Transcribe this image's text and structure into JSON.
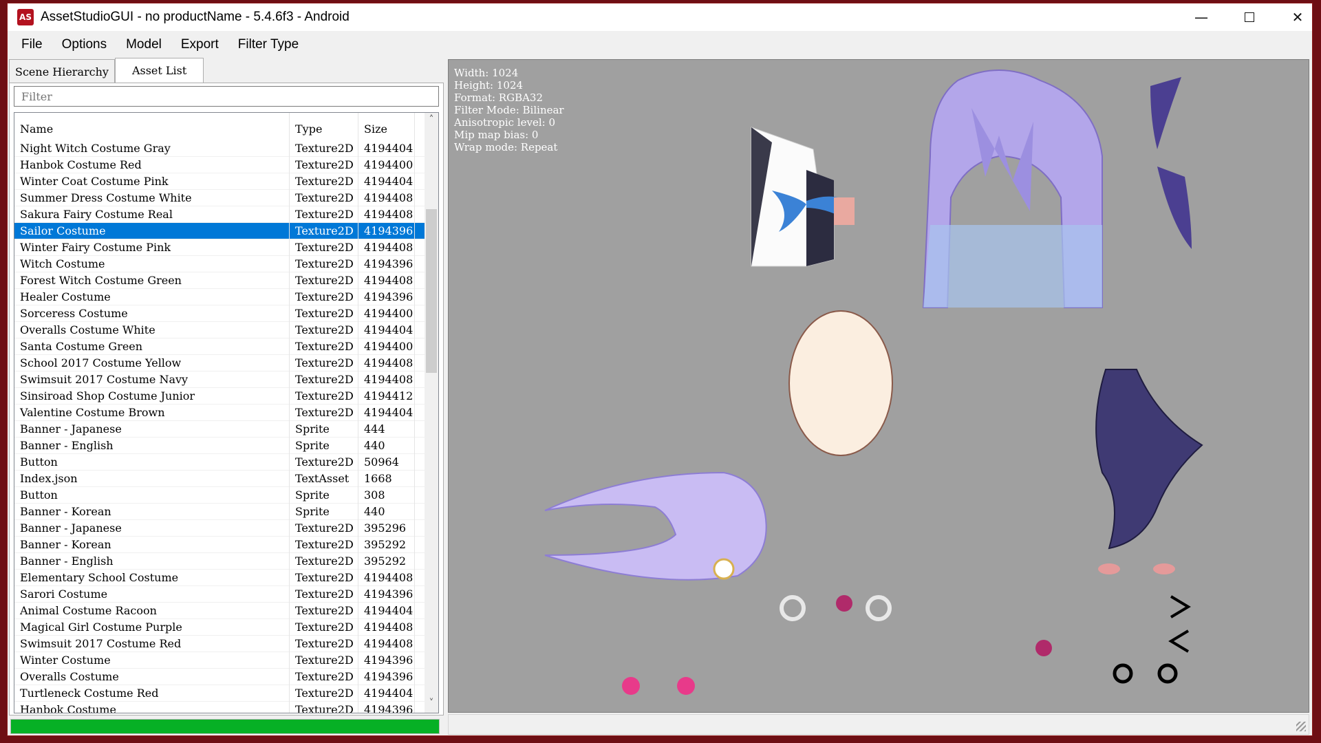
{
  "window": {
    "title": "AssetStudioGUI - no productName - 5.4.6f3 - Android",
    "icon_text": "AS"
  },
  "menu": [
    "File",
    "Options",
    "Model",
    "Export",
    "Filter Type"
  ],
  "tabs": [
    "Scene Hierarchy",
    "Asset List"
  ],
  "filter": {
    "placeholder": "Filter"
  },
  "list": {
    "columns": [
      "Name",
      "Type",
      "Size"
    ],
    "rows": [
      {
        "name": "Night Witch Costume Gray",
        "type": "Texture2D",
        "size": "4194404"
      },
      {
        "name": "Hanbok Costume Red",
        "type": "Texture2D",
        "size": "4194400"
      },
      {
        "name": "Winter Coat Costume Pink",
        "type": "Texture2D",
        "size": "4194404"
      },
      {
        "name": "Summer Dress Costume White",
        "type": "Texture2D",
        "size": "4194408"
      },
      {
        "name": "Sakura Fairy Costume Real",
        "type": "Texture2D",
        "size": "4194408"
      },
      {
        "name": "Sailor Costume",
        "type": "Texture2D",
        "size": "4194396"
      },
      {
        "name": "Winter Fairy Costume Pink",
        "type": "Texture2D",
        "size": "4194408"
      },
      {
        "name": "Witch Costume",
        "type": "Texture2D",
        "size": "4194396"
      },
      {
        "name": "Forest Witch Costume Green",
        "type": "Texture2D",
        "size": "4194408"
      },
      {
        "name": "Healer Costume",
        "type": "Texture2D",
        "size": "4194396"
      },
      {
        "name": "Sorceress Costume",
        "type": "Texture2D",
        "size": "4194400"
      },
      {
        "name": "Overalls Costume White",
        "type": "Texture2D",
        "size": "4194404"
      },
      {
        "name": "Santa Costume Green",
        "type": "Texture2D",
        "size": "4194400"
      },
      {
        "name": "School 2017 Costume Yellow",
        "type": "Texture2D",
        "size": "4194408"
      },
      {
        "name": "Swimsuit 2017 Costume Navy",
        "type": "Texture2D",
        "size": "4194408"
      },
      {
        "name": "Sinsiroad Shop Costume Junior",
        "type": "Texture2D",
        "size": "4194412"
      },
      {
        "name": "Valentine Costume Brown",
        "type": "Texture2D",
        "size": "4194404"
      },
      {
        "name": "Banner - Japanese",
        "type": "Sprite",
        "size": "444"
      },
      {
        "name": "Banner - English",
        "type": "Sprite",
        "size": "440"
      },
      {
        "name": "Button",
        "type": "Texture2D",
        "size": "50964"
      },
      {
        "name": "Index.json",
        "type": "TextAsset",
        "size": "1668"
      },
      {
        "name": "Button",
        "type": "Sprite",
        "size": "308"
      },
      {
        "name": "Banner - Korean",
        "type": "Sprite",
        "size": "440"
      },
      {
        "name": "Banner - Japanese",
        "type": "Texture2D",
        "size": "395296"
      },
      {
        "name": "Banner - Korean",
        "type": "Texture2D",
        "size": "395292"
      },
      {
        "name": "Banner - English",
        "type": "Texture2D",
        "size": "395292"
      },
      {
        "name": "Elementary School Costume",
        "type": "Texture2D",
        "size": "4194408"
      },
      {
        "name": "Sarori Costume",
        "type": "Texture2D",
        "size": "4194396"
      },
      {
        "name": "Animal Costume Racoon",
        "type": "Texture2D",
        "size": "4194404"
      },
      {
        "name": "Magical Girl Costume Purple",
        "type": "Texture2D",
        "size": "4194408"
      },
      {
        "name": "Swimsuit 2017 Costume Red",
        "type": "Texture2D",
        "size": "4194408"
      },
      {
        "name": "Winter Costume",
        "type": "Texture2D",
        "size": "4194396"
      },
      {
        "name": "Overalls Costume",
        "type": "Texture2D",
        "size": "4194396"
      },
      {
        "name": "Turtleneck Costume Red",
        "type": "Texture2D",
        "size": "4194404"
      },
      {
        "name": "Hanbok Costume",
        "type": "Texture2D",
        "size": "4194396"
      }
    ],
    "selected_index": 5
  },
  "preview_info": [
    "Width: 1024",
    "Height: 1024",
    "Format: RGBA32",
    "Filter Mode: Bilinear",
    "Anisotropic level: 0",
    "Mip map bias: 0",
    "Wrap mode: Repeat"
  ],
  "progress": {
    "fraction": 1.0
  },
  "colors": {
    "selection": "#0078d7",
    "progress": "#06b025",
    "preview_bg": "#a0a0a0",
    "desktop": "#6e0f14"
  },
  "icons": {
    "minimize": "minimize-icon",
    "maximize": "maximize-icon",
    "close": "close-icon",
    "scroll_up": "chevron-up-icon",
    "scroll_down": "chevron-down-icon"
  }
}
